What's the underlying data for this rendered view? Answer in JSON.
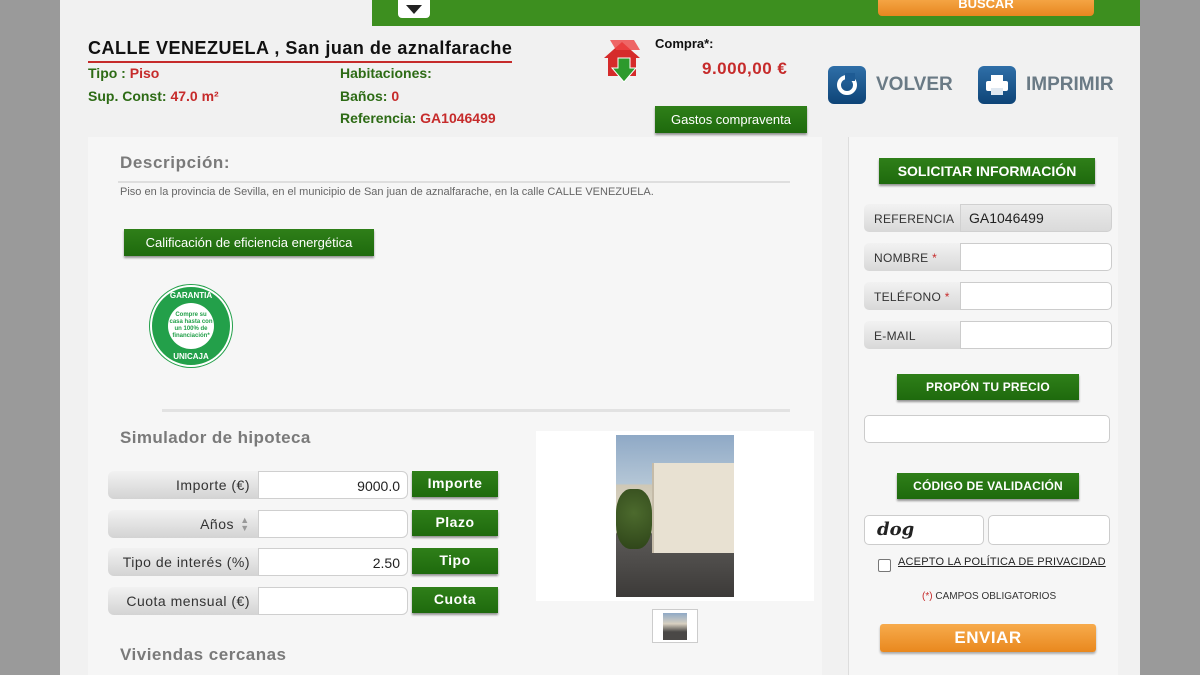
{
  "topbar": {
    "search_label": "BUSCAR"
  },
  "property": {
    "title": "CALLE VENEZUELA , San juan de aznalfarache",
    "tipo_label": "Tipo : ",
    "tipo_value": "Piso",
    "sup_label": "Sup. Const: ",
    "sup_value": "47.0 m²",
    "habitaciones_label": "Habitaciones:",
    "banos_label": "Baños: ",
    "banos_value": "0",
    "referencia_label": "Referencia: ",
    "referencia_value": "GA1046499"
  },
  "price": {
    "label": "Compra*:",
    "value": "9.000,00 €",
    "gastos_button": "Gastos compraventa"
  },
  "actions": {
    "back_label": "VOLVER",
    "print_label": "IMPRIMIR"
  },
  "description": {
    "title": "Descripción:",
    "text": "Piso en la provincia de Sevilla, en el municipio de San juan de aznalfarache, en la calle CALLE VENEZUELA.",
    "energy_button": "Calificación de eficiencia energética"
  },
  "badge": {
    "top_text": "GARANTIA",
    "inner_text": "Compre su casa hasta con un 100% de financiación*",
    "bottom_text": "UNICAJA"
  },
  "simulator": {
    "title": "Simulador de hipoteca",
    "rows": [
      {
        "label": "Importe (€)",
        "value": "9000.0",
        "button": "Importe"
      },
      {
        "label": "Años",
        "value": "",
        "button": "Plazo"
      },
      {
        "label": "Tipo de interés (%)",
        "value": "2.50",
        "button": "Tipo"
      },
      {
        "label": "Cuota mensual (€)",
        "value": "",
        "button": "Cuota"
      }
    ]
  },
  "nearby": {
    "title": "Viviendas cercanas"
  },
  "contact_form": {
    "title": "SOLICITAR INFORMACIÓN",
    "fields": [
      {
        "label": "REFERENCIA",
        "value": "GA1046499",
        "required": ""
      },
      {
        "label": "NOMBRE",
        "value": "",
        "required": "*"
      },
      {
        "label": "TELÉFONO",
        "value": "",
        "required": "*"
      },
      {
        "label": "E-MAIL",
        "value": "",
        "required": ""
      }
    ],
    "price_offer_title": "PROPÓN TU PRECIO",
    "captcha_title": "CÓDIGO DE VALIDACIÓN",
    "captcha_text": "dog",
    "privacy_label": "ACEPTO LA POLÍTICA DE PRIVACIDAD",
    "required_note_mark": "(*)",
    "required_note": " CAMPOS OBLIGATORIOS",
    "submit_label": "ENVIAR"
  },
  "colors": {
    "brand_green": "#2f7f19",
    "accent_red": "#c62b2b",
    "accent_orange": "#e9881e"
  }
}
